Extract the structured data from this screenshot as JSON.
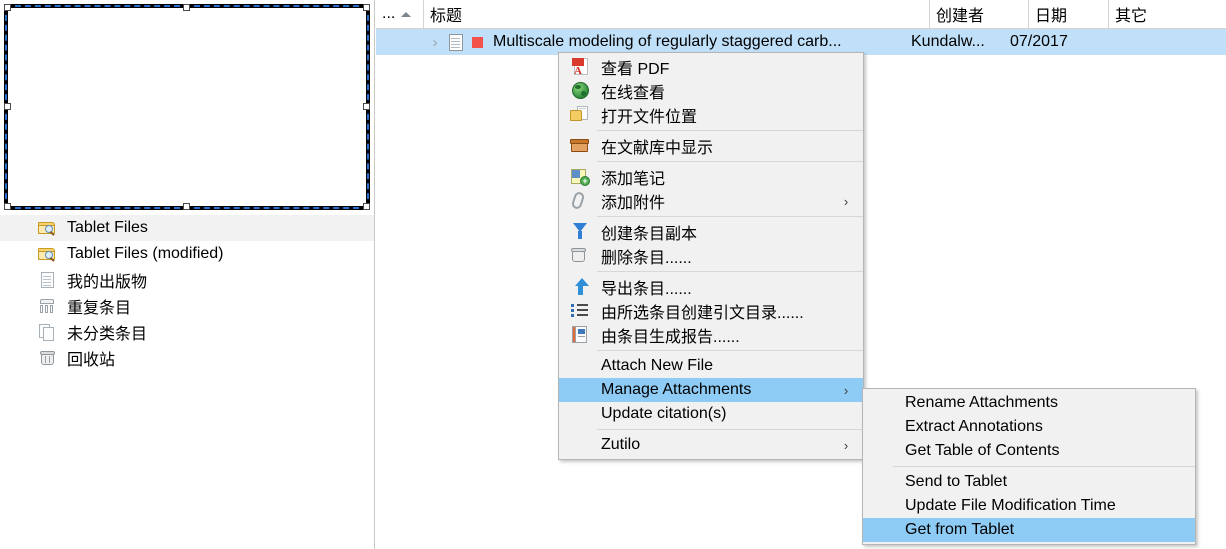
{
  "sidebar": {
    "items": [
      {
        "label": "Tablet Files",
        "icon": "folder-search-icon",
        "selected": true
      },
      {
        "label": "Tablet Files (modified)",
        "icon": "folder-search-icon",
        "selected": false
      },
      {
        "label": "我的出版物",
        "icon": "document-icon",
        "selected": false
      },
      {
        "label": "重复条目",
        "icon": "duplicate-items-icon",
        "selected": false
      },
      {
        "label": "未分类条目",
        "icon": "unfiled-items-icon",
        "selected": false
      },
      {
        "label": "回收站",
        "icon": "trash-icon",
        "selected": false
      }
    ]
  },
  "items_pane": {
    "columns": [
      {
        "label": "...",
        "sort": "asc"
      },
      {
        "label": "标题"
      },
      {
        "label": "创建者"
      },
      {
        "label": "日期"
      },
      {
        "label": "其它"
      }
    ],
    "rows": [
      {
        "title": "Multiscale modeling of regularly staggered carb...",
        "creator": "Kundalw...",
        "date": "07/2017",
        "other": "",
        "selected": true,
        "twisty": "›",
        "tag_color": "#f2524a"
      }
    ]
  },
  "context_menu": {
    "items": [
      {
        "label": "查看 PDF",
        "icon": "pdf-icon",
        "submenu": false,
        "highlighted": false,
        "separator_after": false
      },
      {
        "label": "在线查看",
        "icon": "globe-icon",
        "submenu": false,
        "highlighted": false,
        "separator_after": false
      },
      {
        "label": "打开文件位置",
        "icon": "open-location-icon",
        "submenu": false,
        "highlighted": false,
        "separator_after": true
      },
      {
        "label": "在文献库中显示",
        "icon": "library-box-icon",
        "submenu": false,
        "highlighted": false,
        "separator_after": true
      },
      {
        "label": "添加笔记",
        "icon": "add-note-icon",
        "submenu": false,
        "highlighted": false,
        "separator_after": false
      },
      {
        "label": "添加附件",
        "icon": "paperclip-icon",
        "submenu": true,
        "highlighted": false,
        "separator_after": true
      },
      {
        "label": "创建条目副本",
        "icon": "duplicate-item-icon",
        "submenu": false,
        "highlighted": false,
        "separator_after": false
      },
      {
        "label": "删除条目......",
        "icon": "delete-item-icon",
        "submenu": false,
        "highlighted": false,
        "separator_after": true
      },
      {
        "label": "导出条目......",
        "icon": "export-icon",
        "submenu": false,
        "highlighted": false,
        "separator_after": false
      },
      {
        "label": "由所选条目创建引文目录......",
        "icon": "bibliography-icon",
        "submenu": false,
        "highlighted": false,
        "separator_after": false
      },
      {
        "label": "由条目生成报告......",
        "icon": "report-icon",
        "submenu": false,
        "highlighted": false,
        "separator_after": true
      },
      {
        "label": "Attach New File",
        "icon": "",
        "submenu": false,
        "highlighted": false,
        "separator_after": false
      },
      {
        "label": "Manage Attachments",
        "icon": "",
        "submenu": true,
        "highlighted": true,
        "separator_after": false
      },
      {
        "label": "Update citation(s)",
        "icon": "",
        "submenu": false,
        "highlighted": false,
        "separator_after": true
      },
      {
        "label": "Zutilo",
        "icon": "",
        "submenu": true,
        "highlighted": false,
        "separator_after": false
      }
    ],
    "submenu_arrow": "›"
  },
  "submenu": {
    "items": [
      {
        "label": "Rename Attachments",
        "highlighted": false,
        "separator_after": false
      },
      {
        "label": "Extract Annotations",
        "highlighted": false,
        "separator_after": false
      },
      {
        "label": "Get Table of Contents",
        "highlighted": false,
        "separator_after": true
      },
      {
        "label": "Send to Tablet",
        "highlighted": false,
        "separator_after": false
      },
      {
        "label": "Update File Modification Time",
        "highlighted": false,
        "separator_after": false
      },
      {
        "label": "Get from Tablet",
        "highlighted": true,
        "separator_after": false
      }
    ]
  },
  "colors": {
    "selection_blue": "#bfe0f8",
    "menu_highlight": "#8ecbf5",
    "menu_background": "#f1f1f1",
    "tag_red": "#f2524a"
  }
}
